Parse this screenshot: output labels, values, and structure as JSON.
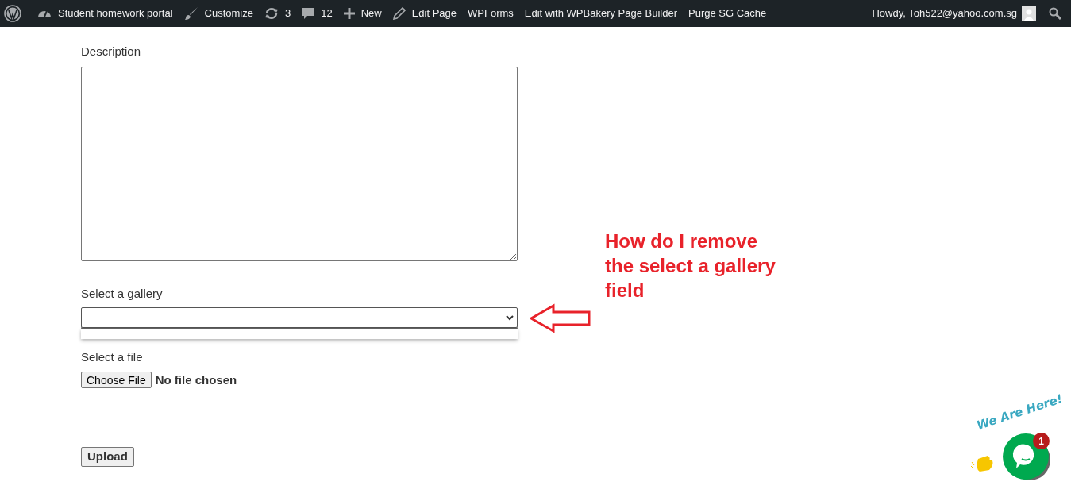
{
  "admin_bar": {
    "items": [
      {
        "kind": "logo"
      },
      {
        "kind": "dashboard",
        "label": "Student homework portal"
      },
      {
        "kind": "brush",
        "label": "Customize"
      },
      {
        "kind": "updates",
        "label": "3"
      },
      {
        "kind": "comments",
        "label": "12"
      },
      {
        "kind": "plus",
        "label": "New"
      },
      {
        "kind": "pencil",
        "label": "Edit Page"
      },
      {
        "kind": "text",
        "label": "WPForms"
      },
      {
        "kind": "text",
        "label": "Edit with WPBakery Page Builder"
      },
      {
        "kind": "text",
        "label": "Purge SG Cache"
      }
    ],
    "account": "Howdy, Toh522@yahoo.com.sg"
  },
  "form": {
    "description_label": "Description",
    "gallery_label": "Select a gallery",
    "file_label": "Select a file",
    "file_button": "Choose File",
    "file_status": "No file chosen",
    "submit": "Upload"
  },
  "annotation": "How do I remove the select a gallery field",
  "chat_widget": {
    "tagline": "We Are Here!",
    "badge": "1"
  }
}
